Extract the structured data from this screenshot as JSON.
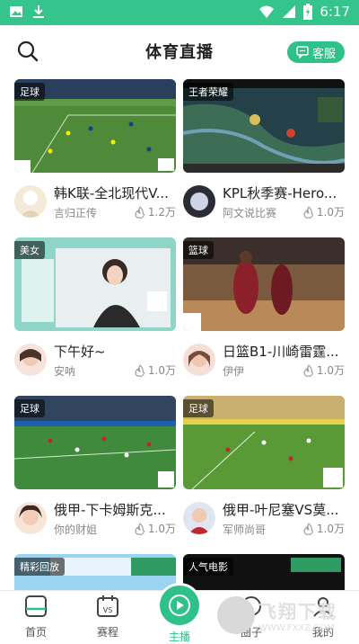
{
  "status_bar": {
    "time": "6:17",
    "icons": [
      "image-icon",
      "download-icon",
      "wifi-icon",
      "signal-icon",
      "battery-icon"
    ]
  },
  "header": {
    "title": "体育直播",
    "search_icon": "search-icon",
    "service_label": "客服",
    "service_icon": "chat-icon"
  },
  "colors": {
    "brand": "#2ec28a",
    "status_bar": "#35c48c",
    "text_primary": "#222222",
    "text_secondary": "#888888"
  },
  "cards": [
    {
      "tag": "足球",
      "title": "韩K联-全北现代V...",
      "author": "言归正传",
      "heat": "1.2万"
    },
    {
      "tag": "王者荣耀",
      "title": "KPL秋季赛-Hero...",
      "author": "阿文说比赛",
      "heat": "1.0万"
    },
    {
      "tag": "美女",
      "title": "下午好~",
      "author": "安呐",
      "heat": "1.0万"
    },
    {
      "tag": "篮球",
      "title": "日篮B1-川崎雷霆...",
      "author": "伊伊",
      "heat": "1.0万"
    },
    {
      "tag": "足球",
      "title": "俄甲-下卡姆斯克...",
      "author": "你的财姐",
      "heat": "1.0万"
    },
    {
      "tag": "足球",
      "title": "俄甲-叶尼塞VS莫...",
      "author": "军师尚哥",
      "heat": "1.0万"
    },
    {
      "tag": "精彩回放",
      "title": "",
      "author": "",
      "heat": ""
    },
    {
      "tag": "人气电影",
      "title": "",
      "author": "",
      "heat": ""
    }
  ],
  "tabs": [
    {
      "label": "首页",
      "icon": "home-icon"
    },
    {
      "label": "赛程",
      "icon": "schedule-icon"
    },
    {
      "label": "主播",
      "icon": "play-icon"
    },
    {
      "label": "圈子",
      "icon": "circle-icon"
    },
    {
      "label": "我的",
      "icon": "profile-icon"
    }
  ],
  "watermark": {
    "main": "飞翔下载",
    "sub": "WWW.FXXZ.COM"
  }
}
